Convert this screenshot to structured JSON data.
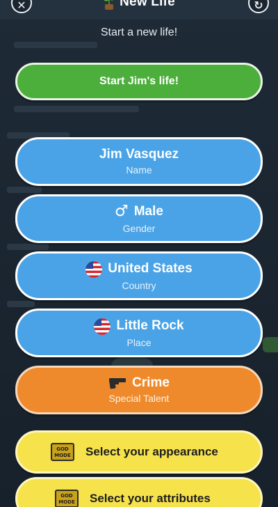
{
  "header": {
    "title": "New Life",
    "subtitle": "Start a new life!",
    "close_icon": "close-icon",
    "reload_icon": "reload-icon",
    "title_icon": "sprout-icon"
  },
  "start_button": {
    "label": "Start Jim's life!"
  },
  "fields": {
    "name": {
      "value": "Jim Vasquez",
      "caption": "Name"
    },
    "gender": {
      "value": "Male",
      "caption": "Gender",
      "icon": "male-symbol-icon"
    },
    "country": {
      "value": "United States",
      "caption": "Country",
      "icon": "us-flag-icon"
    },
    "place": {
      "value": "Little Rock",
      "caption": "Place",
      "icon": "us-flag-icon"
    },
    "talent": {
      "value": "Crime",
      "caption": "Special Talent",
      "icon": "gun-icon"
    }
  },
  "god_mode": {
    "badge_text": "GOD MODE",
    "appearance_label": "Select your appearance",
    "attributes_label": "Select your attributes"
  },
  "colors": {
    "green": "#4caf3b",
    "blue": "#4aa3e6",
    "orange": "#ef8a2c",
    "yellow": "#f6e24a",
    "background": "#1b2530"
  }
}
